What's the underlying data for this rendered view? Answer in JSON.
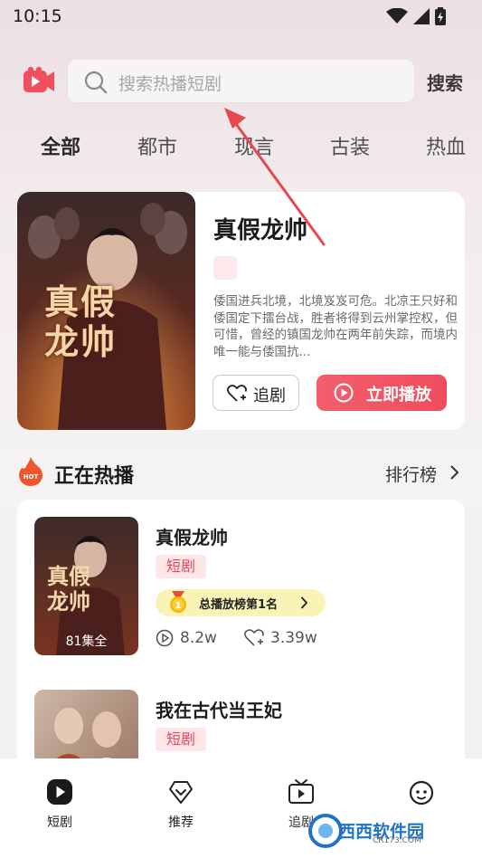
{
  "status_bar": {
    "time": "10:15",
    "icons": [
      "wifi-icon",
      "signal-icon",
      "battery-charging-icon"
    ]
  },
  "header": {
    "logo_icon": "video-camera-icon",
    "search_placeholder": "搜索热播短剧",
    "search_button": "搜索"
  },
  "categories": [
    {
      "label": "全部",
      "active": true
    },
    {
      "label": "都市",
      "active": false
    },
    {
      "label": "现言",
      "active": false
    },
    {
      "label": "古装",
      "active": false
    },
    {
      "label": "热血",
      "active": false
    }
  ],
  "feature": {
    "title": "真假龙帅",
    "poster_text": "真假龙帅",
    "description": "倭国进兵北境，北境岌岌可危。北凉王只好和倭国定下擂台战，胜者将得到云州掌控权，但可惜，曾经的镇国龙帅在两年前失踪，而境内唯一能与倭国抗...",
    "follow_label": "追剧",
    "play_label": "立即播放"
  },
  "hot_section": {
    "title": "正在热播",
    "badge": "HOT",
    "ranking_link": "排行榜"
  },
  "list": [
    {
      "title": "真假龙帅",
      "tag": "短剧",
      "episodes": "81集全",
      "rank_text": "总播放榜第1名",
      "rank_number": "1",
      "plays": "8.2w",
      "likes": "3.39w"
    },
    {
      "title": "我在古代当王妃",
      "tag": "短剧"
    }
  ],
  "bottom_nav": [
    {
      "label": "短剧",
      "icon": "play-circle-icon"
    },
    {
      "label": "推荐",
      "icon": "heart-diamond-icon"
    },
    {
      "label": "追剧",
      "icon": "tv-icon"
    },
    {
      "label": "",
      "icon": "smiley-face-icon"
    }
  ],
  "watermark": {
    "text": "西西软件园",
    "sub": "CR173.COM"
  },
  "colors": {
    "accent": "#ef4d5d",
    "tag_bg": "#fde6e8",
    "rank_bg": "#fbf2b5"
  }
}
